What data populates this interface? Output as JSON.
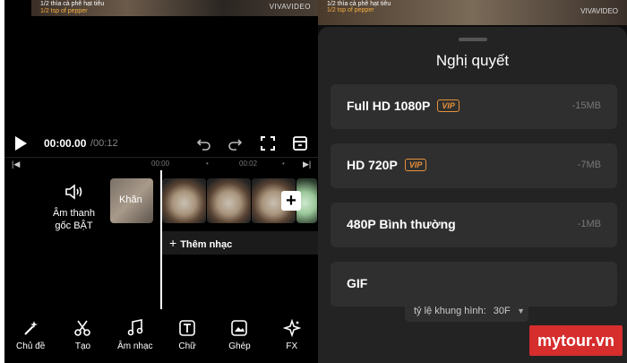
{
  "left": {
    "video_caption": [
      "1/2 thìa cà phê hạt tiêu",
      "1/2 tsp of pepper"
    ],
    "watermark": "VIVAVIDEO",
    "time_current": "00:00.00",
    "time_total": "/00:12",
    "ruler_ticks": [
      "00:00",
      "00:02"
    ],
    "audio_label_line1": "Âm thanh",
    "audio_label_line2": "gốc BẬT",
    "clip_text": "Khăn",
    "add_music": "Thêm nhạc",
    "toolbar": [
      {
        "label": "Chủ đề",
        "icon": "magic-wand-icon"
      },
      {
        "label": "Tạo",
        "icon": "scissors-icon"
      },
      {
        "label": "Âm nhạc",
        "icon": "music-note-icon"
      },
      {
        "label": "Chữ",
        "icon": "text-icon"
      },
      {
        "label": "Ghép",
        "icon": "image-overlay-icon"
      },
      {
        "label": "FX",
        "icon": "sparkle-icon"
      }
    ]
  },
  "right": {
    "watermark": "VIVAVIDEO",
    "video_caption": [
      "1/2 thìa cà phê hạt tiêu",
      "1/2 tsp of pepper"
    ],
    "title": "Nghị quyết",
    "options": [
      {
        "label": "Full HD 1080P",
        "vip": "VIP",
        "size": "-15MB"
      },
      {
        "label": "HD 720P",
        "vip": "VIP",
        "size": "-7MB"
      },
      {
        "label": "480P Bình thường",
        "vip": "",
        "size": "-1MB"
      },
      {
        "label": "GIF",
        "vip": "",
        "size": ""
      }
    ],
    "ratio_label": "tỷ lệ khung hình:",
    "ratio_value": "30F"
  },
  "brand": "mytour.vn",
  "colors": {
    "vip": "#e8923a",
    "brand_bg": "#d62d2d"
  }
}
